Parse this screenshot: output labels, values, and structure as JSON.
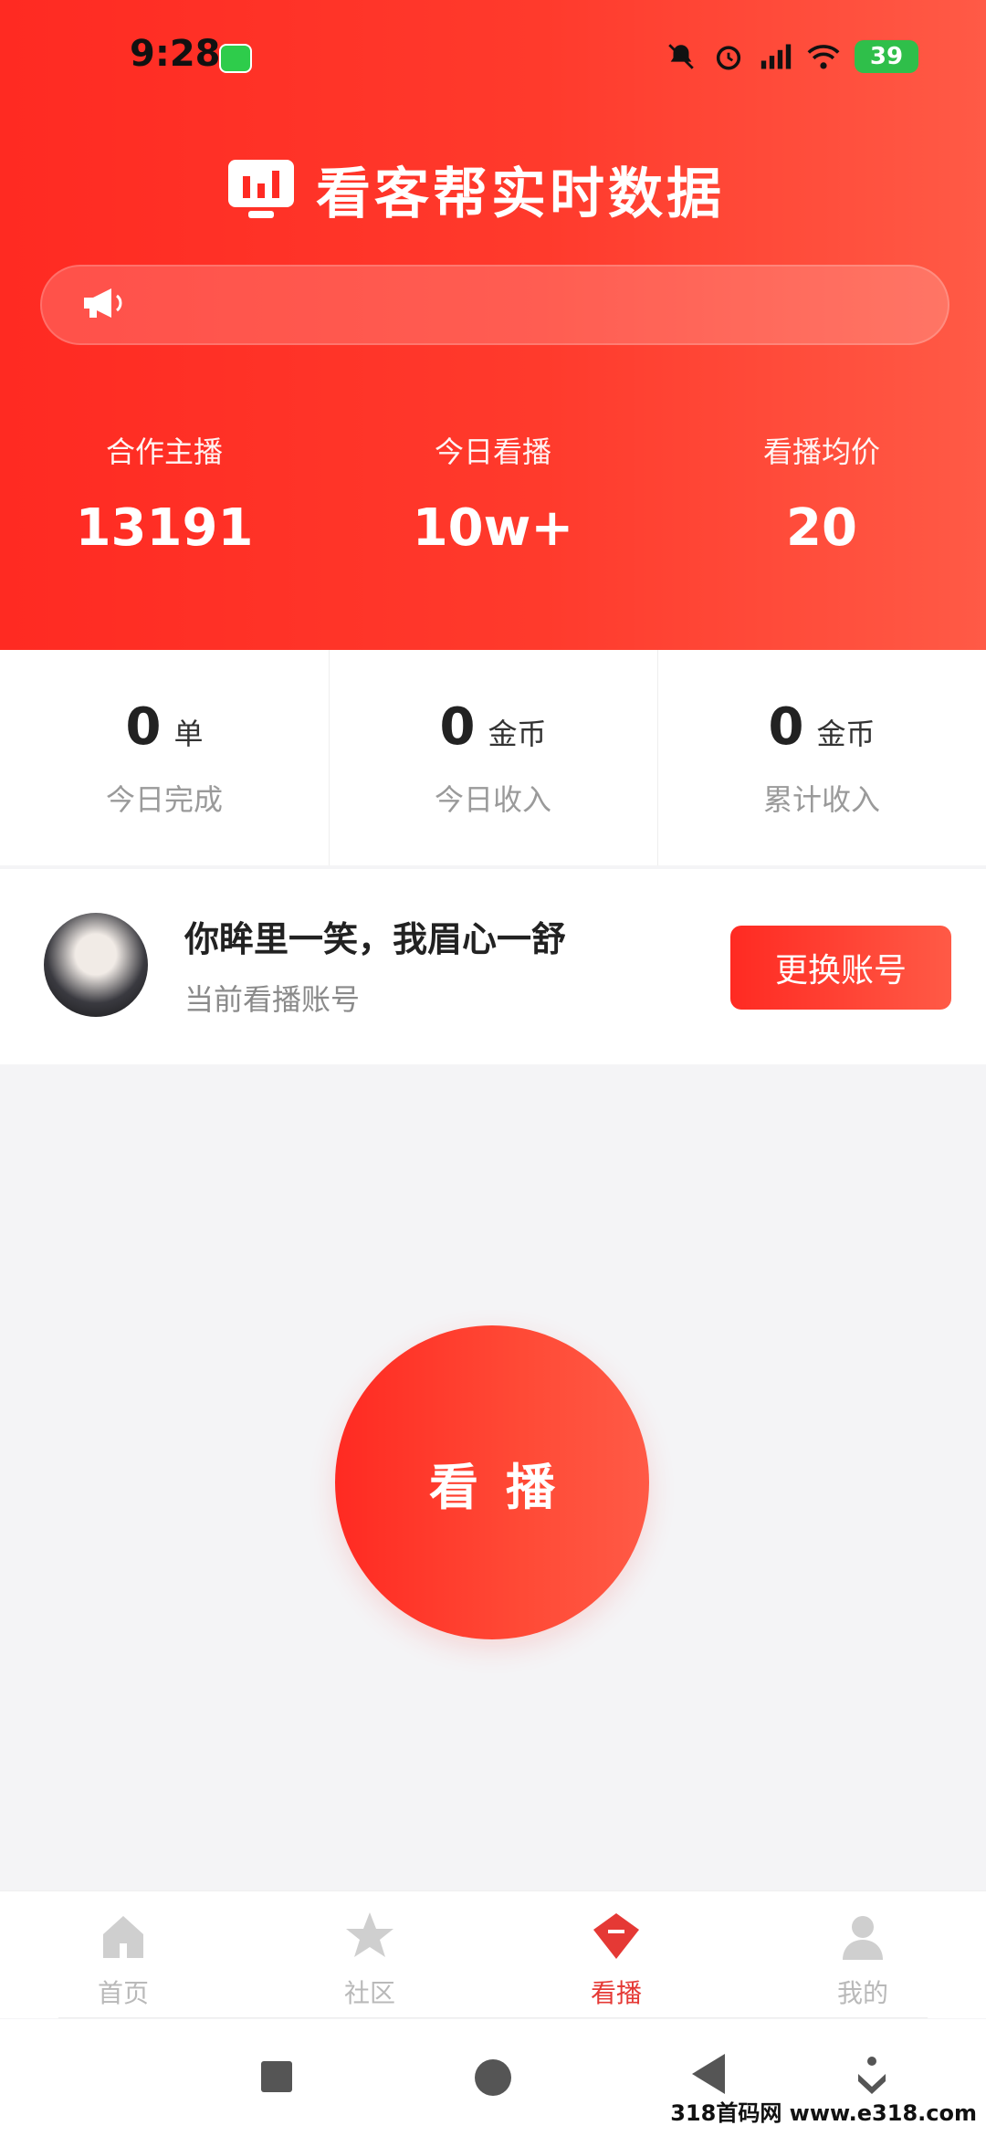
{
  "status_bar": {
    "time": "9:28",
    "battery": "39"
  },
  "header": {
    "brand_title": "看客帮实时数据",
    "notice_text": "",
    "stats": [
      {
        "label": "合作主播",
        "value": "13191"
      },
      {
        "label": "今日看播",
        "value": "10w+"
      },
      {
        "label": "看播均价",
        "value": "20"
      }
    ]
  },
  "summary": [
    {
      "value": "0",
      "unit": "单",
      "label": "今日完成"
    },
    {
      "value": "0",
      "unit": "金币",
      "label": "今日收入"
    },
    {
      "value": "0",
      "unit": "金币",
      "label": "累计收入"
    }
  ],
  "account": {
    "name": "你眸里一笑，我眉心一舒",
    "subtitle": "当前看播账号",
    "switch_label": "更换账号"
  },
  "main": {
    "watch_button_label": "看播"
  },
  "tabs": [
    {
      "label": "首页",
      "icon": "home-icon"
    },
    {
      "label": "社区",
      "icon": "star-icon"
    },
    {
      "label": "看播",
      "icon": "diamond-icon",
      "active": true
    },
    {
      "label": "我的",
      "icon": "user-icon"
    }
  ],
  "watermark": "318首码网 www.e318.com",
  "colors": {
    "accent": "#ff2a22",
    "accent_end": "#ff5a46",
    "active_tab": "#e53935"
  }
}
